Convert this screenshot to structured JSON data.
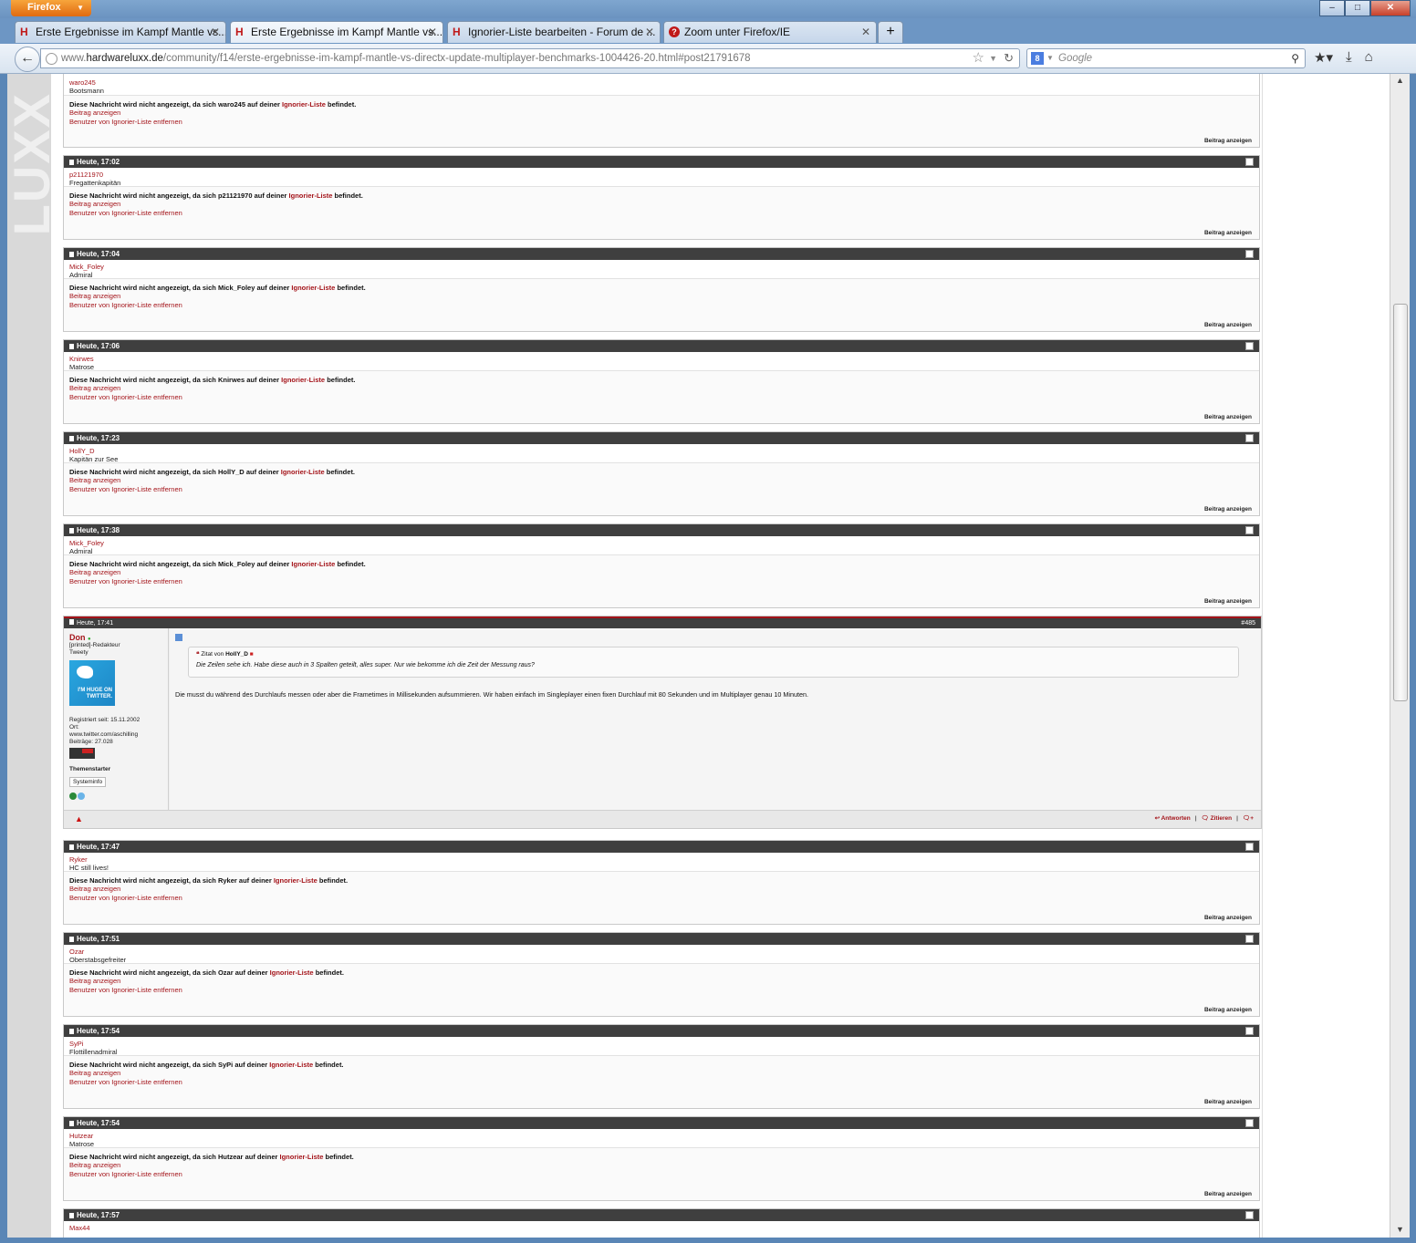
{
  "browser": {
    "menu_label": "Firefox",
    "tabs": [
      {
        "title": "Erste Ergebnisse im Kampf Mantle vs...."
      },
      {
        "title": "Erste Ergebnisse im Kampf Mantle vs...."
      },
      {
        "title": "Ignorier-Liste bearbeiten - Forum de ..."
      },
      {
        "title": "Zoom unter Firefox/IE"
      }
    ],
    "url_prefix": "www.",
    "url_domain": "hardwareluxx.de",
    "url_path": "/community/f14/erste-ergebnisse-im-kampf-mantle-vs-directx-update-multiplayer-benchmarks-1004426-20.html#post21791678",
    "search_placeholder": "Google"
  },
  "labels": {
    "ignored_pre": "Diese Nachricht wird nicht angezeigt, da sich ",
    "ignored_mid": " auf deiner ",
    "ignored_link": "Ignorier-Liste",
    "ignored_post": " befindet.",
    "show_post": "Beitrag anzeigen",
    "remove_user": "Benutzer von Ignorier-Liste entfernen",
    "show_post_right": "Beitrag anzeigen"
  },
  "posts_before": [
    {
      "time": "",
      "user": "waro245",
      "rank": "Bootsmann"
    },
    {
      "time": "Heute, 17:02",
      "user": "p21121970",
      "rank": "Fregattenkapitän"
    },
    {
      "time": "Heute, 17:04",
      "user": "Mick_Foley",
      "rank": "Admiral"
    },
    {
      "time": "Heute, 17:06",
      "user": "Knirwes",
      "rank": "Matrose"
    },
    {
      "time": "Heute, 17:23",
      "user": "HollY_D",
      "rank": "Kapitän zur See"
    },
    {
      "time": "Heute, 17:38",
      "user": "Mick_Foley",
      "rank": "Admiral"
    }
  ],
  "don_post": {
    "time": "Heute, 17:41",
    "number": "#485",
    "user": "Don",
    "role": "[printed]-Redakteur",
    "subrole": "Tweety",
    "avatar_text": "I'M HUGE ON TWITTER.",
    "registered": "Registriert seit: 15.11.2002",
    "location_label": "Ort:",
    "location": "www.twitter.com/aschilling",
    "posts": "Beiträge: 27.028",
    "starter": "Themenstarter",
    "sysinfo": "Systeminfo",
    "quote_prefix": "Zitat von",
    "quote_author": "HollY_D",
    "quote_text": "Die Zeilen sehe ich. Habe diese auch in 3 Spalten geteilt, alles super. Nur wie bekomme ich die Zeit der Messung raus?",
    "text": "Die musst du während des Durchlaufs messen oder aber die Frametimes in Millisekunden aufsummieren. Wir haben einfach im Singleplayer einen fixen Durchlauf mit 80 Sekunden und im Multiplayer genau 10 Minuten.",
    "reply": "Antworten",
    "quote_btn": "Zitieren"
  },
  "posts_after": [
    {
      "time": "Heute, 17:47",
      "user": "Ryker",
      "rank": "HC still lives!"
    },
    {
      "time": "Heute, 17:51",
      "user": "Ozar",
      "rank": "Oberstabsgefreiter"
    },
    {
      "time": "Heute, 17:54",
      "user": "SyPi",
      "rank": "Flottillenadmiral"
    },
    {
      "time": "Heute, 17:54",
      "user": "Hutzear",
      "rank": "Matrose"
    },
    {
      "time": "Heute, 17:57",
      "user": "Max44",
      "rank": ""
    }
  ],
  "colors": {
    "accent": "#a4141a",
    "header": "#3f3f3f"
  }
}
